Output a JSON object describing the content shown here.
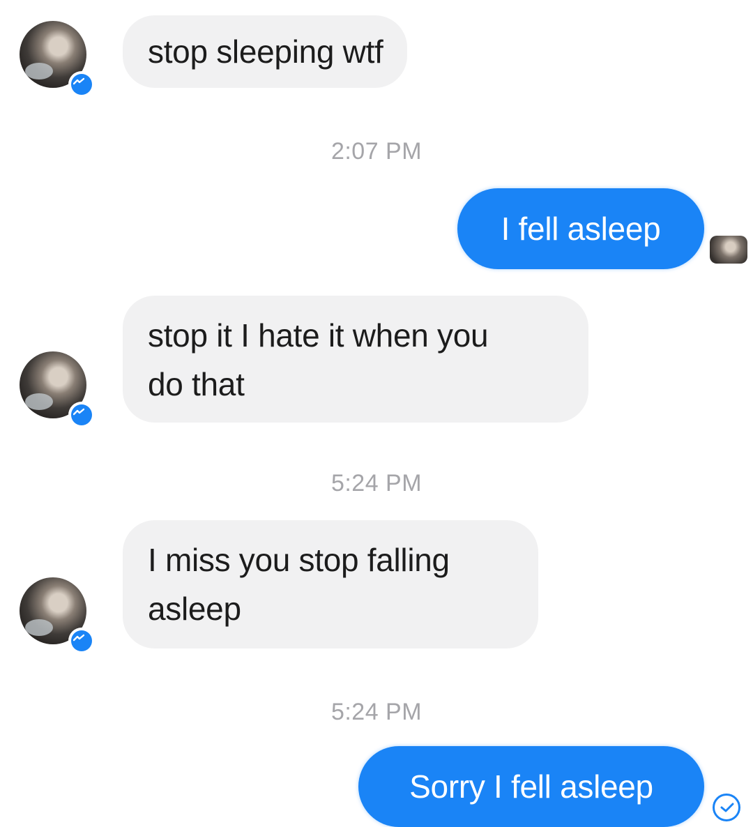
{
  "accent_color": "#1a84f6",
  "incoming_bubble_color": "#f1f1f2",
  "messages": [
    {
      "direction": "incoming",
      "lines": [
        "stop sleeping wtf"
      ]
    },
    {
      "direction": "outgoing",
      "text": "I fell asleep"
    },
    {
      "direction": "incoming",
      "lines": [
        "stop it I hate it when you",
        "do that"
      ]
    },
    {
      "direction": "incoming",
      "lines": [
        "I miss you stop falling",
        "asleep"
      ]
    },
    {
      "direction": "outgoing",
      "text": "Sorry I fell asleep"
    }
  ],
  "timestamps": [
    "2:07 PM",
    "5:24 PM",
    "5:24 PM"
  ],
  "icons": {
    "avatar_badge": "messenger-badge-icon",
    "read_receipt": "seen-check-icon"
  }
}
